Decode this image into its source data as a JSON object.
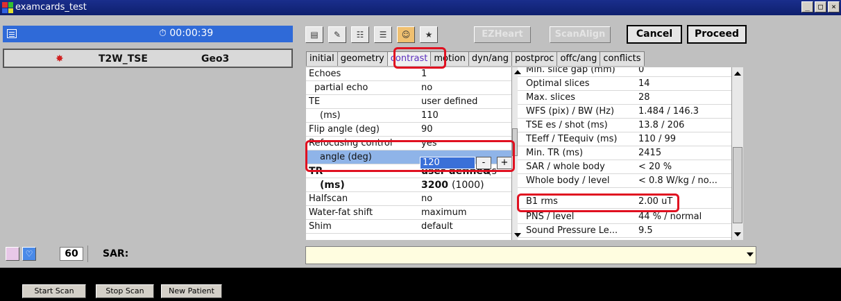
{
  "window": {
    "title": "examcards_test",
    "controls": [
      "_",
      "□",
      "×"
    ]
  },
  "left": {
    "timer": "00:00:39",
    "scan": {
      "name": "T2W_TSE",
      "geo": "Geo3"
    },
    "sar": {
      "count": "60",
      "label": "SAR:"
    }
  },
  "toolbar": {
    "icons": [
      "card-icon",
      "edit-icon",
      "list-icon",
      "grid-icon",
      "person-icon",
      "wand-icon"
    ],
    "ezheart": "EZHeart",
    "scanalign": "ScanAlign",
    "cancel": "Cancel",
    "proceed": "Proceed"
  },
  "tabs": [
    "initial",
    "geometry",
    "contrast",
    "motion",
    "dyn/ang",
    "postproc",
    "offc/ang",
    "conflicts"
  ],
  "active_tab": "contrast",
  "params_left": [
    {
      "label": "Echoes",
      "value": "1"
    },
    {
      "label": "  partial echo",
      "value": "no"
    },
    {
      "label": "TE",
      "value": "user defined"
    },
    {
      "label": "  (ms)",
      "value": "110"
    },
    {
      "label": "Flip angle (deg)",
      "value": "90"
    },
    {
      "label": "Refocusing control",
      "value": "yes"
    },
    {
      "label": "  angle (deg)",
      "value": "120"
    },
    {
      "label": "TR",
      "value": "user defined",
      "suffix": "(s"
    },
    {
      "label": "  (ms)",
      "value": "3200",
      "extra": "(1000)"
    },
    {
      "label": "Halfscan",
      "value": "no"
    },
    {
      "label": "Water-fat shift",
      "value": "maximum"
    },
    {
      "label": "Shim",
      "value": "default"
    }
  ],
  "stepper": {
    "value": "120",
    "minus": "-",
    "plus": "+"
  },
  "params_right": [
    {
      "label": "Min. slice gap (mm)",
      "value": "0"
    },
    {
      "label": "Optimal slices",
      "value": "14"
    },
    {
      "label": "Max. slices",
      "value": "28"
    },
    {
      "label": "WFS (pix) / BW (Hz)",
      "value": "1.484 / 146.3"
    },
    {
      "label": "TSE es / shot (ms)",
      "value": "13.8 / 206"
    },
    {
      "label": "TEeff / TEequiv (ms)",
      "value": "110 / 99"
    },
    {
      "label": "Min. TR (ms)",
      "value": "2415"
    },
    {
      "label": "SAR / whole body",
      "value": "< 20 %"
    },
    {
      "label": "Whole body / level",
      "value": "< 0.8 W/kg / no..."
    },
    {
      "label": "B1 rms",
      "value": "2.00 uT"
    },
    {
      "label": "PNS / level",
      "value": "44 % / normal"
    },
    {
      "label": "Sound Pressure Le...",
      "value": "9.5"
    }
  ],
  "bottom_buttons": [
    "Start Scan",
    "Stop Scan",
    "New Patient"
  ],
  "colors": {
    "highlight": "#e01020",
    "timer_bar": "#2f6ad8",
    "active_tab": "#5a2dbe"
  }
}
